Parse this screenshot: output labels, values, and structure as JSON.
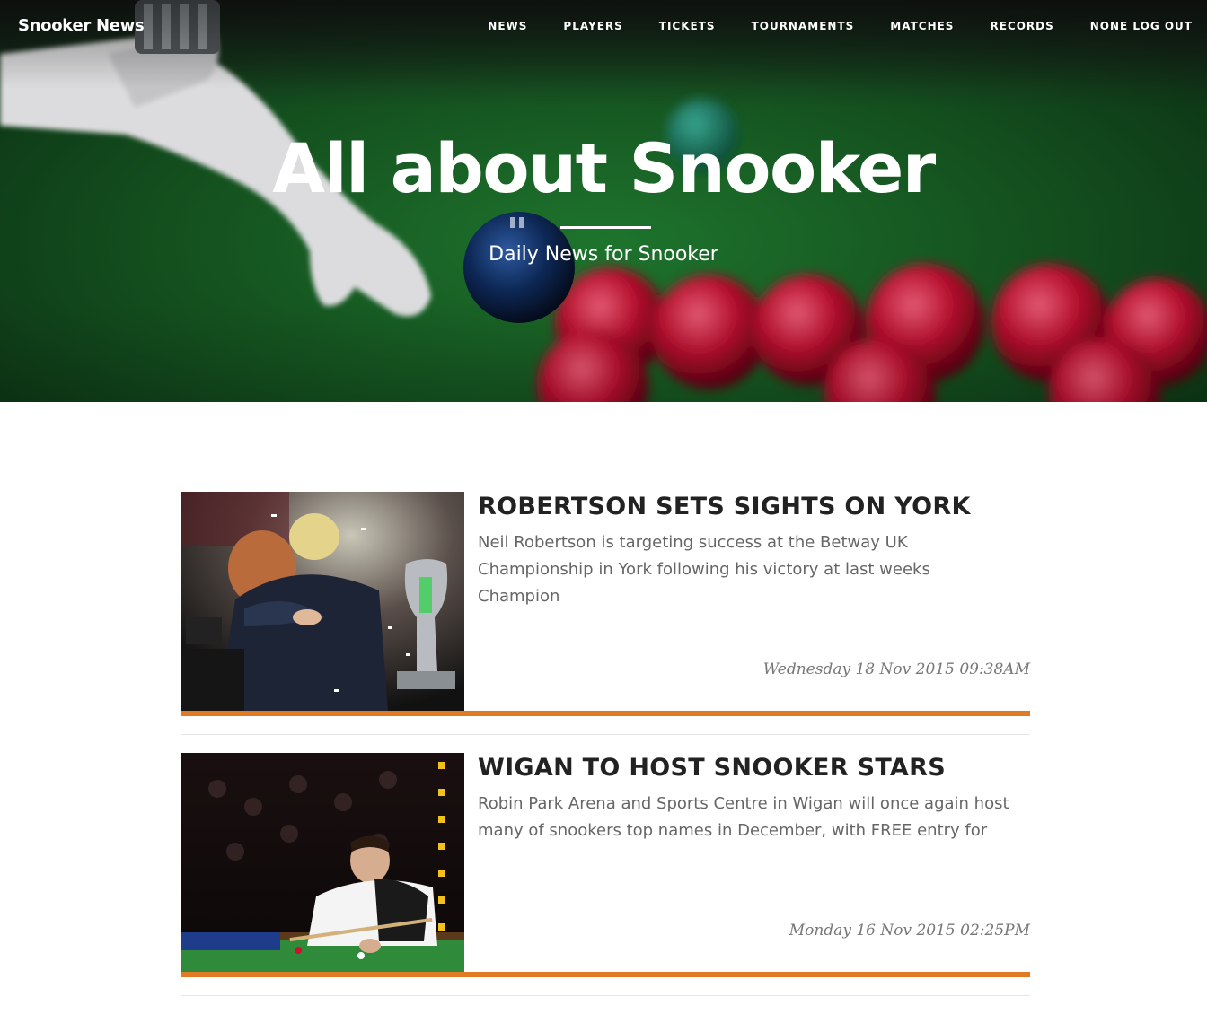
{
  "nav": {
    "brand": "Snooker News",
    "links": [
      {
        "label": "NEWS"
      },
      {
        "label": "PLAYERS"
      },
      {
        "label": "TICKETS"
      },
      {
        "label": "TOURNAMENTS"
      },
      {
        "label": "MATCHES"
      },
      {
        "label": "RECORDS"
      },
      {
        "label": "NONE LOG OUT"
      }
    ]
  },
  "hero": {
    "title": "All about Snooker",
    "subtitle": "Daily News for Snooker"
  },
  "articles": [
    {
      "title": "ROBERTSON SETS SIGHTS ON YORK",
      "summary": "Neil Robertson is targeting success at the Betway UK Championship in York following his victory at last weeks Champion",
      "date": "Wednesday 18 Nov 2015 09:38AM"
    },
    {
      "title": "WIGAN TO HOST SNOOKER STARS",
      "summary": "Robin Park Arena and Sports Centre in Wigan will once again host many of snookers top names in December, with FREE entry for",
      "date": "Monday 16 Nov 2015 02:25PM"
    }
  ],
  "colors": {
    "accent": "#e07b24",
    "felt": "#1f7a2f",
    "title_text": "#222222",
    "summary_text": "#666666"
  }
}
